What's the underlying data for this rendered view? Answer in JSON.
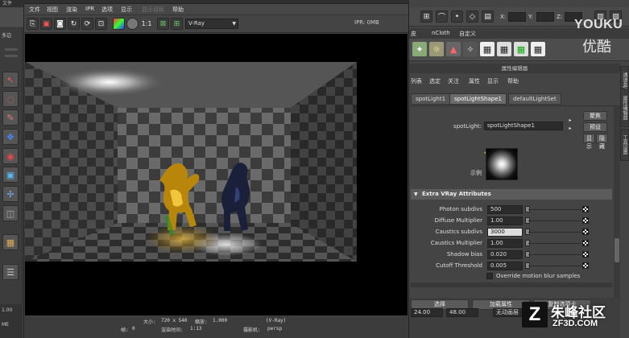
{
  "maya": {
    "top_menu": "文件",
    "left_tab": "多边",
    "status": [
      "ME",
      "1.00"
    ],
    "shelf_tabs": [
      "皮",
      "nCloth",
      "自定义"
    ],
    "tool_fields": [
      "X:",
      "Y:",
      "Z:"
    ]
  },
  "render_view": {
    "menus": [
      "文件",
      "视图",
      "渲染",
      "IPR",
      "选项",
      "显示",
      "显示目标",
      "帮助"
    ],
    "menus_disabled": [
      false,
      false,
      false,
      false,
      false,
      false,
      true,
      false
    ],
    "zoom_label": "1:1",
    "renderer": "V-Ray",
    "ipr_status": "IPR: 0MB",
    "info": {
      "size_label": "大小:",
      "size_value": "720 x 540",
      "zoom_label": "缩放:",
      "zoom_value": "1.000",
      "renderer_tag": "(V-Ray)",
      "frame_label": "帧:",
      "frame_value": "0",
      "time_label": "渲染时间:",
      "time_value": "1:13",
      "camera_label": "摄影机:",
      "camera_value": "persp"
    }
  },
  "attribute_editor": {
    "title": "属性编辑器",
    "menus": [
      "列表",
      "选定",
      "关注",
      "属性",
      "显示",
      "帮助"
    ],
    "tabs": [
      "spotLight1",
      "spotLightShape1",
      "defaultLightSet"
    ],
    "active_tab": 1,
    "node_label": "spotLight:",
    "node_name": "spotLightShape1",
    "buttons": {
      "focus": "聚焦",
      "presets": "预设",
      "show": "显示",
      "hide": "隐藏"
    },
    "sample_label": "示例",
    "section_title": "Extra VRay Attributes",
    "attributes": [
      {
        "label": "Photon subdivs",
        "value": "500",
        "slider": 0.0
      },
      {
        "label": "Diffuse Multiplier",
        "value": "1.00",
        "slider": 0.0
      },
      {
        "label": "Caustics subdivs",
        "value": "3000",
        "slider": 0.0
      },
      {
        "label": "Caustics Multiplier",
        "value": "1.00",
        "slider": 0.0
      },
      {
        "label": "Shadow bias",
        "value": "0.020",
        "slider": 0.0
      },
      {
        "label": "Cutoff Threshold",
        "value": "0.005",
        "slider": 0.0
      }
    ],
    "checkbox_label": "Override motion blur samples",
    "bottom": {
      "select_btn": "选择",
      "load_btn": "加载属性",
      "copy_tab": "复制选项卡",
      "vals": [
        "24.00",
        "48.00",
        "无动画层"
      ]
    },
    "side_tabs": [
      "通道盒/层编辑器",
      "属性编辑器",
      "工具设置"
    ]
  },
  "watermarks": {
    "youku_en": "YOUKU",
    "youku_cn": "优酷",
    "site_cn": "朱峰社区",
    "site_en": "ZF3D.COM"
  },
  "colors": {
    "window_bg": "#3f3f3f",
    "active_tab": "#6b6b6b",
    "section": "#5b5b5b"
  }
}
